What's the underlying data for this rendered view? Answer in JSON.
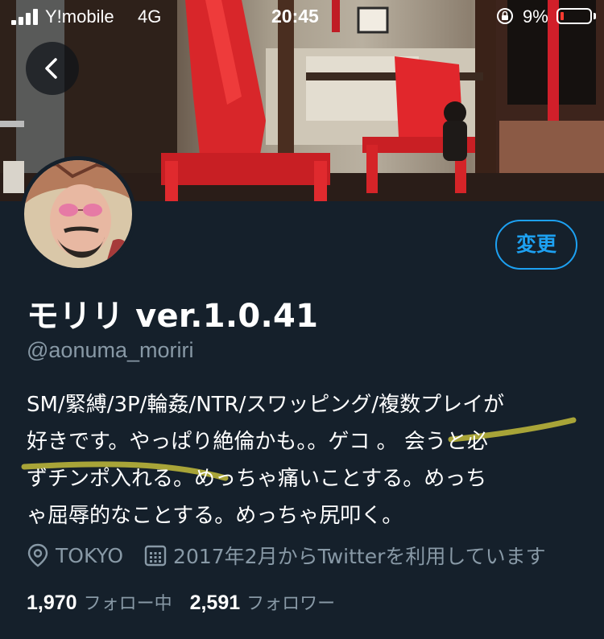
{
  "status_bar": {
    "carrier": "Y!mobile",
    "network": "4G",
    "time": "20:45",
    "battery_percent": "9%",
    "battery_color": "#ff3b30"
  },
  "header": {
    "back_icon": "chevron-left-icon"
  },
  "profile": {
    "edit_button_label": "変更",
    "display_name": "モリリ ver.1.0.41",
    "handle": "@aonuma_moriri",
    "bio": "SM/緊縛/3P/輪姦/NTR/スワッピング/複数プレイが\n好きです。やっぱり絶倫かも。。ゲコ 。 会うと必\nずチンポ入れる。めっちゃ痛いことする。めっち\nゃ屈辱的なことする。めっちゃ尻叩く。",
    "location": "TOKYO",
    "location_icon": "location-pin-icon",
    "joined": "2017年2月からTwitterを利用しています",
    "joined_icon": "calendar-icon",
    "following_count": "1,970",
    "following_label": "フォロー中",
    "followers_count": "2,591",
    "followers_label": "フォロワー"
  },
  "colors": {
    "background": "#15202b",
    "accent": "#1da1f2",
    "secondary_text": "#8899a6",
    "highlight_marker": "#b8b23a"
  }
}
